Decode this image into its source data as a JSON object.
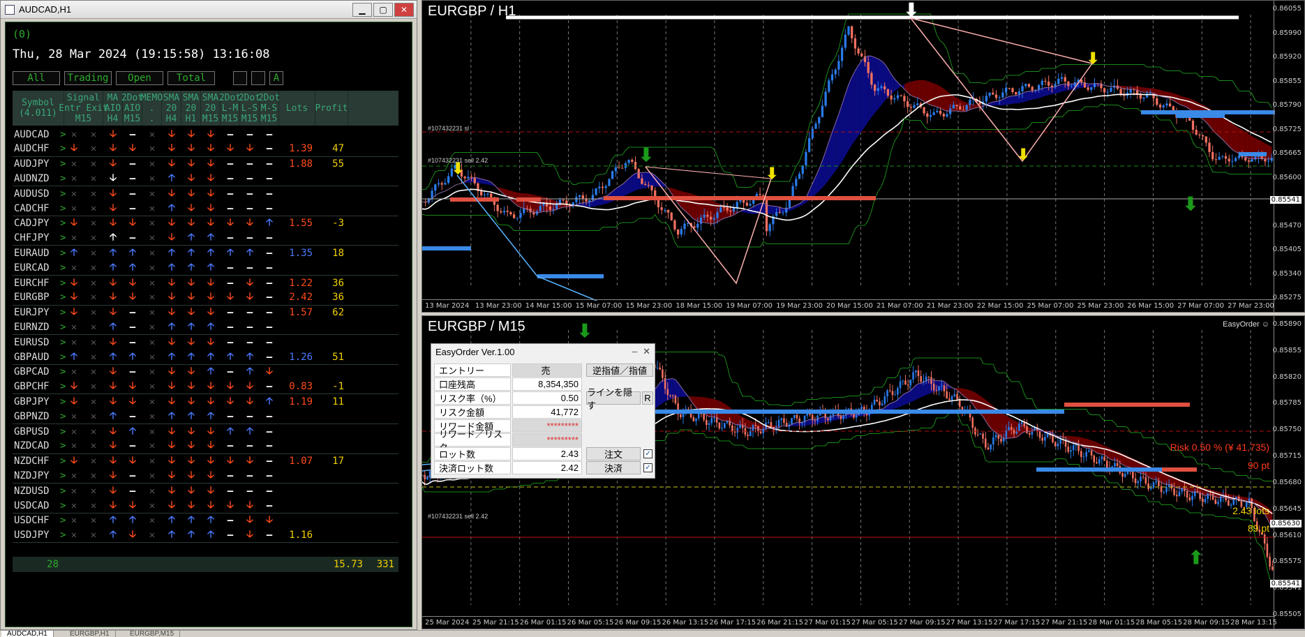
{
  "left_window": {
    "title": "AUDCAD,H1",
    "account": "(0)",
    "datetime": "Thu, 28 Mar 2024 (19:15:58) 13:16:08",
    "filters": [
      "All",
      "Trading",
      "Open",
      "Total"
    ],
    "filter_extra": "A",
    "headers": [
      "Symbol\n(4.011)",
      "Signal\nEntr Exit\nM15",
      "MA\nAIO\nH4",
      "2Dot\nAIO\nM15",
      "MEMO\n.\n.",
      "SMA\n20\nH4",
      "SMA\n20\nH1",
      "SMA\n20\nM15",
      "2Dot\nL-M\nM15",
      "2Dot\nL-S\nM15",
      "2Dot\nM-S\nM15",
      "Lots",
      "Profit"
    ],
    "rows": [
      {
        "sym": "AUDCAD",
        "c": [
          "x",
          "x",
          "D",
          "-",
          "x",
          "D",
          "D",
          "D",
          "-",
          "-",
          "-"
        ],
        "lots": "",
        "profit": "",
        "lc": "red"
      },
      {
        "sym": "AUDCHF",
        "c": [
          "D",
          "x",
          "D",
          "D",
          "x",
          "D",
          "D",
          "D",
          "D",
          "D",
          "-"
        ],
        "lots": "1.39",
        "profit": "47",
        "lc": "red"
      },
      {
        "sym": "AUDJPY",
        "c": [
          "x",
          "x",
          "D",
          "-",
          "x",
          "D",
          "D",
          "D",
          "-",
          "-",
          "-"
        ],
        "lots": "1.88",
        "profit": "55",
        "lc": "red"
      },
      {
        "sym": "AUDNZD",
        "c": [
          "x",
          "x",
          "W",
          "-",
          "x",
          "U",
          "D",
          "D",
          "-",
          "-",
          "-"
        ],
        "lots": "",
        "profit": "",
        "lc": "red"
      },
      {
        "sym": "AUDUSD",
        "c": [
          "x",
          "x",
          "D",
          "-",
          "x",
          "D",
          "D",
          "D",
          "-",
          "-",
          "-"
        ],
        "lots": "",
        "profit": "",
        "lc": "red"
      },
      {
        "sym": "CADCHF",
        "c": [
          "x",
          "x",
          "D",
          "-",
          "x",
          "U",
          "D",
          "D",
          "-",
          "-",
          "-"
        ],
        "lots": "",
        "profit": "",
        "lc": "red"
      },
      {
        "sym": "CADJPY",
        "c": [
          "D",
          "x",
          "D",
          "D",
          "x",
          "D",
          "D",
          "D",
          "D",
          "D",
          "U"
        ],
        "lots": "1.55",
        "profit": "-3",
        "lc": "red"
      },
      {
        "sym": "CHFJPY",
        "c": [
          "x",
          "x",
          "WU",
          "-",
          "x",
          "D",
          "U",
          "U",
          "-",
          "-",
          "-"
        ],
        "lots": "",
        "profit": "",
        "lc": "red"
      },
      {
        "sym": "EURAUD",
        "c": [
          "U",
          "x",
          "U",
          "U",
          "x",
          "U",
          "U",
          "U",
          "U",
          "U",
          "-"
        ],
        "lots": "1.35",
        "profit": "18",
        "lc": "blue"
      },
      {
        "sym": "EURCAD",
        "c": [
          "x",
          "x",
          "U",
          "U",
          "x",
          "U",
          "U",
          "U",
          "-",
          "-",
          "-"
        ],
        "lots": "",
        "profit": "",
        "lc": "red"
      },
      {
        "sym": "EURCHF",
        "c": [
          "D",
          "x",
          "D",
          "D",
          "x",
          "D",
          "D",
          "D",
          "-",
          "D",
          "-"
        ],
        "lots": "1.22",
        "profit": "36",
        "lc": "red"
      },
      {
        "sym": "EURGBP",
        "c": [
          "D",
          "x",
          "D",
          "D",
          "x",
          "D",
          "D",
          "D",
          "D",
          "D",
          "-"
        ],
        "lots": "2.42",
        "profit": "36",
        "lc": "red"
      },
      {
        "sym": "EURJPY",
        "c": [
          "D",
          "x",
          "D",
          "-",
          "x",
          "D",
          "D",
          "D",
          "-",
          "-",
          "-"
        ],
        "lots": "1.57",
        "profit": "62",
        "lc": "red"
      },
      {
        "sym": "EURNZD",
        "c": [
          "x",
          "x",
          "U",
          "-",
          "x",
          "U",
          "U",
          "U",
          "-",
          "-",
          "-"
        ],
        "lots": "",
        "profit": "",
        "lc": "red"
      },
      {
        "sym": "EURUSD",
        "c": [
          "x",
          "x",
          "D",
          "-",
          "x",
          "D",
          "D",
          "D",
          "-",
          "-",
          "-"
        ],
        "lots": "",
        "profit": "",
        "lc": "red"
      },
      {
        "sym": "GBPAUD",
        "c": [
          "U",
          "x",
          "U",
          "U",
          "x",
          "U",
          "U",
          "U",
          "U",
          "U",
          "-"
        ],
        "lots": "1.26",
        "profit": "51",
        "lc": "blue"
      },
      {
        "sym": "GBPCAD",
        "c": [
          "x",
          "x",
          "D",
          "-",
          "x",
          "D",
          "D",
          "U",
          "-",
          "U",
          "D"
        ],
        "lots": "",
        "profit": "",
        "lc": "red"
      },
      {
        "sym": "GBPCHF",
        "c": [
          "D",
          "x",
          "D",
          "D",
          "x",
          "D",
          "D",
          "D",
          "D",
          "D",
          "-"
        ],
        "lots": "0.83",
        "profit": "-1",
        "lc": "red"
      },
      {
        "sym": "GBPJPY",
        "c": [
          "D",
          "x",
          "D",
          "D",
          "x",
          "D",
          "D",
          "D",
          "D",
          "D",
          "U"
        ],
        "lots": "1.19",
        "profit": "11",
        "lc": "red"
      },
      {
        "sym": "GBPNZD",
        "c": [
          "x",
          "x",
          "U",
          "-",
          "x",
          "U",
          "U",
          "U",
          "-",
          "-",
          "-"
        ],
        "lots": "",
        "profit": "",
        "lc": "red"
      },
      {
        "sym": "GBPUSD",
        "c": [
          "x",
          "x",
          "D",
          "U",
          "x",
          "D",
          "D",
          "D",
          "U",
          "U",
          "-"
        ],
        "lots": "",
        "profit": "",
        "lc": "red"
      },
      {
        "sym": "NZDCAD",
        "c": [
          "x",
          "x",
          "D",
          "-",
          "x",
          "D",
          "D",
          "D",
          "-",
          "-",
          "-"
        ],
        "lots": "",
        "profit": "",
        "lc": "red"
      },
      {
        "sym": "NZDCHF",
        "c": [
          "D",
          "x",
          "D",
          "D",
          "x",
          "D",
          "D",
          "D",
          "D",
          "D",
          "-"
        ],
        "lots": "1.07",
        "profit": "17",
        "lc": "red"
      },
      {
        "sym": "NZDJPY",
        "c": [
          "x",
          "x",
          "D",
          "-",
          "x",
          "D",
          "D",
          "D",
          "-",
          "-",
          "-"
        ],
        "lots": "",
        "profit": "",
        "lc": "red"
      },
      {
        "sym": "NZDUSD",
        "c": [
          "x",
          "x",
          "D",
          "-",
          "x",
          "D",
          "D",
          "D",
          "-",
          "-",
          "-"
        ],
        "lots": "",
        "profit": "",
        "lc": "red"
      },
      {
        "sym": "USDCAD",
        "c": [
          "x",
          "x",
          "D",
          "D",
          "x",
          "D",
          "D",
          "D",
          "D",
          "D",
          "-"
        ],
        "lots": "",
        "profit": "",
        "lc": "red"
      },
      {
        "sym": "USDCHF",
        "c": [
          "x",
          "x",
          "U",
          "U",
          "x",
          "U",
          "U",
          "U",
          "-",
          "D",
          "D"
        ],
        "lots": "",
        "profit": "",
        "lc": "red"
      },
      {
        "sym": "USDJPY",
        "c": [
          "x",
          "x",
          "U",
          "D",
          "x",
          "U",
          "U",
          "U",
          "-",
          "D",
          "-"
        ],
        "lots": "1.16",
        "profit": "",
        "lc": "yel"
      }
    ],
    "footer": {
      "count": "28",
      "lots": "15.73",
      "profit": "331"
    }
  },
  "chart_h1": {
    "title": "EURGBP / H1",
    "prices": [
      "0.86055",
      "0.85990",
      "0.85920",
      "0.85855",
      "0.85790",
      "0.85725",
      "0.85665",
      "0.85600",
      "0.85541",
      "0.85470",
      "0.85405",
      "0.85340",
      "0.85275"
    ],
    "current_price": "0.85541",
    "times": [
      "13 Mar 2024",
      "13 Mar 23:00",
      "14 Mar 15:00",
      "15 Mar 07:00",
      "15 Mar 23:00",
      "18 Mar 15:00",
      "19 Mar 07:00",
      "19 Mar 23:00",
      "20 Mar 15:00",
      "21 Mar 07:00",
      "21 Mar 23:00",
      "22 Mar 15:00",
      "25 Mar 07:00",
      "25 Mar 23:00",
      "26 Mar 15:00",
      "27 Mar 07:00",
      "27 Mar 23:00"
    ],
    "order_label1": "#107432231 sl",
    "order_label2": "#107432231 sell 2.42"
  },
  "chart_m15": {
    "title": "EURGBP / M15",
    "corner": "EasyOrder",
    "prices": [
      "0.85890",
      "0.85855",
      "0.85820",
      "0.85785",
      "0.85750",
      "0.85715",
      "0.85680",
      "0.85645",
      "0.85610",
      "0.85575",
      "0.85541",
      "0.85505"
    ],
    "price_tag_mid": "0.85630",
    "current_price": "0.85541",
    "times": [
      "25 Mar 2024",
      "25 Mar 21:15",
      "26 Mar 01:15",
      "26 Mar 05:15",
      "26 Mar 09:15",
      "26 Mar 13:15",
      "26 Mar 17:15",
      "26 Mar 21:15",
      "27 Mar 01:15",
      "27 Mar 05:15",
      "27 Mar 09:15",
      "27 Mar 13:15",
      "27 Mar 17:15",
      "27 Mar 21:15",
      "28 Mar 01:15",
      "28 Mar 05:15",
      "28 Mar 09:15",
      "28 Mar 13:15"
    ],
    "risk_text": "Risk 0.50 % (¥ 41,735)",
    "pt_top": "90 pt",
    "lots_text": "2.43 lots",
    "pt_bottom": "89 pt",
    "order_label": "#107432231 sell 2.42"
  },
  "easyorder": {
    "title": "EasyOrder Ver.1.00",
    "entry_label": "エントリー",
    "entry_value": "売",
    "btn_limit": "逆指値／指値",
    "balance_label": "口座残高",
    "balance_value": "8,354,350",
    "risk_label": "リスク率（%）",
    "risk_value": "0.50",
    "btn_hide": "ラインを隠す",
    "btn_r": "R",
    "riskamt_label": "リスク金額",
    "riskamt_value": "41,772",
    "reward_label": "リワード金額",
    "reward_value": "*********",
    "rr_label": "リワード／リスク",
    "rr_value": "*********",
    "lot_label": "ロット数",
    "lot_value": "2.43",
    "btn_order": "注文",
    "close_label": "決済ロット数",
    "close_value": "2.42",
    "btn_close": "決済"
  },
  "tabs": [
    "AUDCAD,H1",
    "EURGBP,H1",
    "EURGBP,M15"
  ]
}
